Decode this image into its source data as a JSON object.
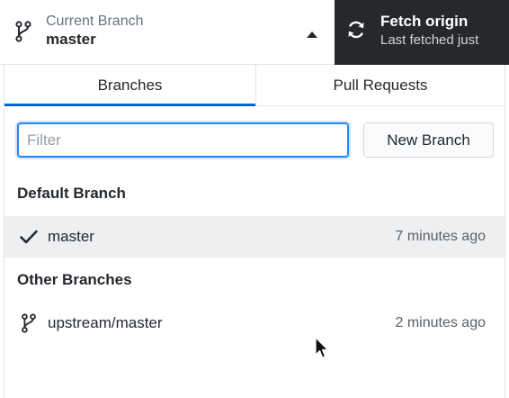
{
  "toolbar": {
    "current_branch": {
      "caption": "Current Branch",
      "name": "master",
      "icon": "git-branch-icon",
      "caret_icon": "caret-up-icon"
    },
    "fetch": {
      "title": "Fetch origin",
      "subtitle": "Last fetched just",
      "icon": "sync-icon"
    }
  },
  "panel": {
    "tabs": [
      {
        "label": "Branches",
        "selected": true
      },
      {
        "label": "Pull Requests",
        "selected": false
      }
    ],
    "filter": {
      "placeholder": "Filter",
      "value": ""
    },
    "new_branch_label": "New Branch",
    "sections": [
      {
        "header": "Default Branch",
        "branches": [
          {
            "name": "master",
            "time": "7 minutes ago",
            "icon": "check-icon",
            "highlighted": true
          }
        ]
      },
      {
        "header": "Other Branches",
        "branches": [
          {
            "name": "upstream/master",
            "time": "2 minutes ago",
            "icon": "git-branch-icon",
            "highlighted": false
          }
        ]
      }
    ]
  },
  "colors": {
    "accent": "#0366d6",
    "focus": "#2188ff",
    "dark_toolbar": "#24292e",
    "row_highlight": "#eeeff1"
  }
}
